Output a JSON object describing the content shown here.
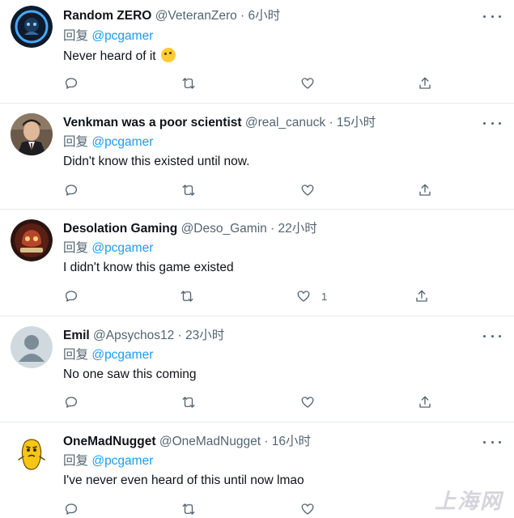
{
  "replies": [
    {
      "name": "Random ZERO",
      "handle_time": "@VeteranZero · 6小时",
      "reply_prefix": "回复",
      "reply_to": "@pcgamer",
      "text": "Never heard of it",
      "like_count": "",
      "avatar": "dark-circle-logo"
    },
    {
      "name": "Venkman was a poor scientist",
      "handle_time": "@real_canuck · 15小时",
      "reply_prefix": "回复",
      "reply_to": "@pcgamer",
      "text": "Didn't know this existed until now.",
      "like_count": "",
      "avatar": "man-in-suit-photo"
    },
    {
      "name": "Desolation Gaming",
      "handle_time": "@Deso_Gamin · 22小时",
      "reply_prefix": "回复",
      "reply_to": "@pcgamer",
      "text": "I didn't know this game existed",
      "like_count": "1",
      "avatar": "gaming-badge-logo"
    },
    {
      "name": "Emil",
      "handle_time": "@Apsychos12 · 23小时",
      "reply_prefix": "回复",
      "reply_to": "@pcgamer",
      "text": "No one saw this coming",
      "like_count": "",
      "avatar": "default-person"
    },
    {
      "name": "OneMadNugget",
      "handle_time": "@OneMadNugget · 16小时",
      "reply_prefix": "回复",
      "reply_to": "@pcgamer",
      "text": "I've never even heard of this until now lmao",
      "like_count": "",
      "avatar": "yellow-nugget-cartoon"
    }
  ],
  "icons": [
    "reply-icon",
    "retweet-icon",
    "like-icon",
    "share-icon",
    "more-icon"
  ],
  "colors": {
    "link": "#1d9bf0",
    "muted": "#536471",
    "text": "#0f1419",
    "divider": "#e6eaed"
  },
  "watermark": "上海网"
}
